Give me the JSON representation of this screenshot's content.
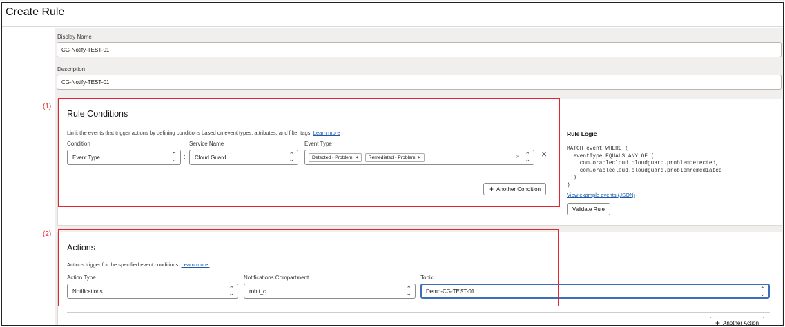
{
  "title": "Create Rule",
  "display_name": {
    "label": "Display Name",
    "value": "CG-Notify-TEST-01"
  },
  "description": {
    "label": "Description",
    "value": "CG-Notify-TEST-01"
  },
  "markers": {
    "one": "(1)",
    "two": "(2)"
  },
  "rule_conditions": {
    "title": "Rule Conditions",
    "help_text": "Limit the events that trigger actions by defining conditions based on event types, attributes, and filter tags.",
    "learn_more": "Learn more",
    "condition_label": "Condition",
    "condition_value": "Event Type",
    "colon": ":",
    "service_label": "Service Name",
    "service_value": "Cloud Guard",
    "event_type_label": "Event Type",
    "chips": [
      "Detected - Problem",
      "Remediated - Problem"
    ],
    "another_condition": "Another Condition"
  },
  "rule_logic": {
    "title": "Rule Logic",
    "code": "MATCH event WHERE (\n  eventType EQUALS ANY OF (\n    com.oraclecloud.cloudguard.problemdetected,\n    com.oraclecloud.cloudguard.problemremediated\n  )\n)",
    "view_example": "View example events (JSON)",
    "validate": "Validate Rule"
  },
  "actions": {
    "title": "Actions",
    "help_text": "Actions trigger for the specified event conditions.",
    "learn_more": "Learn more.",
    "action_type_label": "Action Type",
    "action_type_value": "Notifications",
    "compartment_label": "Notifications Compartment",
    "compartment_value": "rohit_c",
    "topic_label": "Topic",
    "topic_value": "Demo-CG-TEST-01",
    "another_action": "Another Action"
  },
  "icons": {
    "chevron": "updown-chevron-icon",
    "remove": "close-icon",
    "plus": "plus-icon"
  },
  "colors": {
    "annotation": "#e0262e",
    "link": "#1a5aa8",
    "focus": "#3d6fb8"
  }
}
